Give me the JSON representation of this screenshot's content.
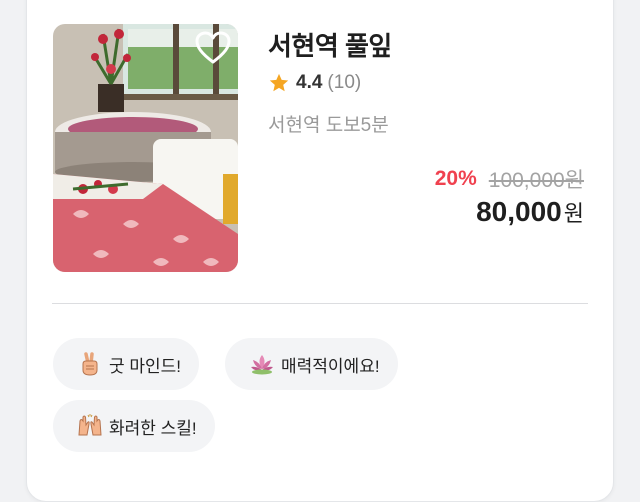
{
  "shop": {
    "name": "서현역 풀잎",
    "rating": "4.4",
    "review_count": "(10)",
    "location": "서현역 도보5분"
  },
  "price": {
    "discount": "20%",
    "original": "100,000원",
    "final": "80,000",
    "final_unit": "원"
  },
  "tags": [
    {
      "label": "굿 마인드!",
      "icon": "peace-hand-icon"
    },
    {
      "label": "매력적이에요!",
      "icon": "lotus-icon"
    },
    {
      "label": "화려한 스킬!",
      "icon": "raised-hands-icon"
    }
  ],
  "colors": {
    "discount": "#f0414f",
    "star": "#f5a623",
    "title": "#1f1f1f",
    "muted": "#9a9a9a"
  }
}
